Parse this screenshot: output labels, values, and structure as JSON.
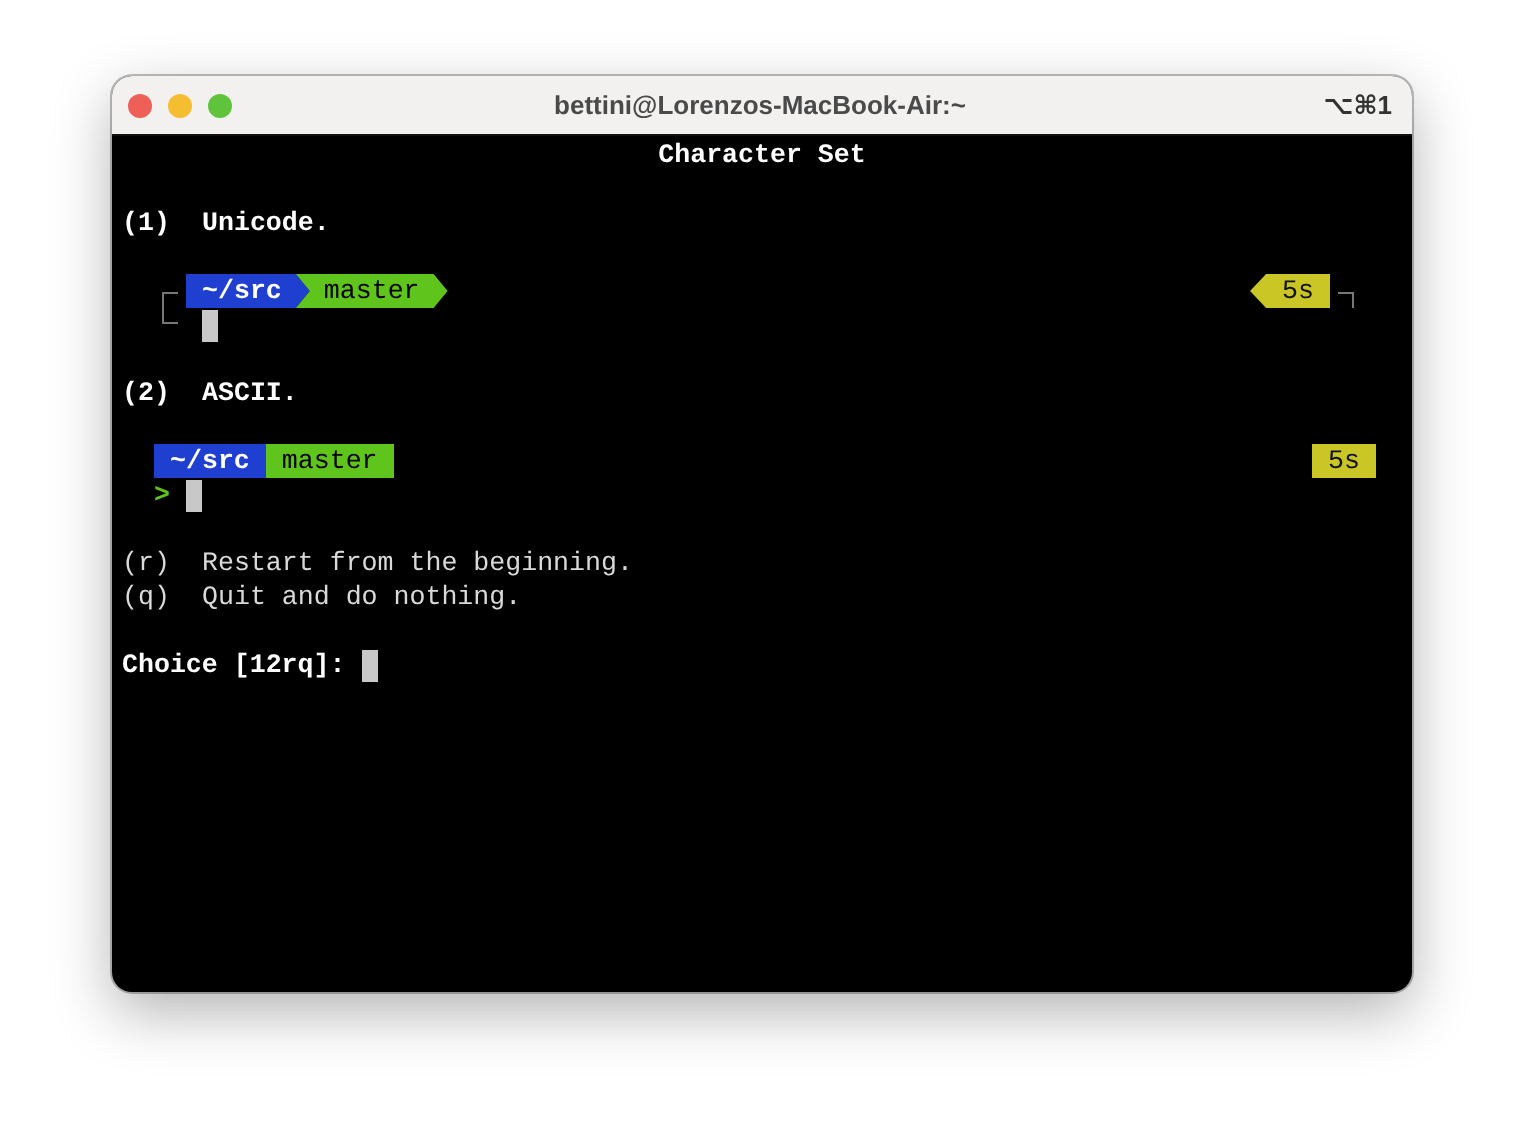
{
  "window": {
    "title": "bettini@Lorenzos-MacBook-Air:~",
    "shortcut": "⌥⌘1"
  },
  "heading": "Character Set",
  "options": [
    {
      "kind": "unicode",
      "key": "(1)",
      "label": "Unicode.",
      "prompt": {
        "dir": "~/src",
        "branch": "master",
        "duration": "5s"
      }
    },
    {
      "kind": "ascii",
      "key": "(2)",
      "label": "ASCII.",
      "prompt": {
        "dir": "~/src",
        "branch": "master",
        "duration": "5s",
        "symbol": ">"
      }
    }
  ],
  "menu": [
    {
      "key": "(r)",
      "label": "Restart from the beginning."
    },
    {
      "key": "(q)",
      "label": "Quit and do nothing."
    }
  ],
  "choice": "Choice [12rq]:"
}
